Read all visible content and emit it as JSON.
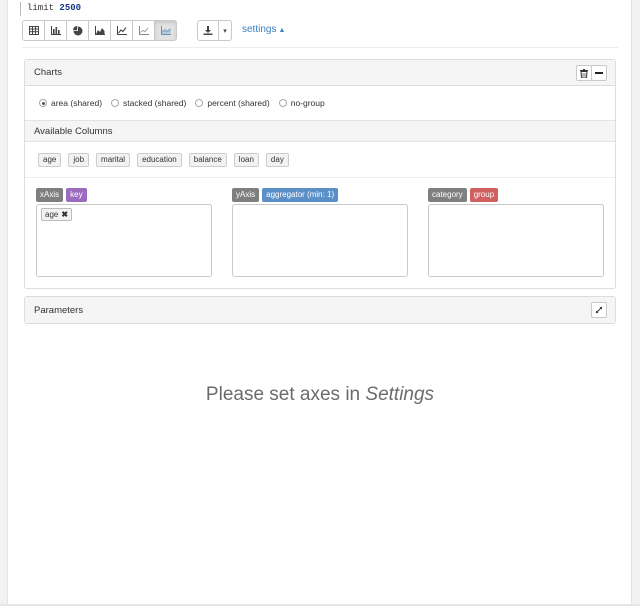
{
  "query": {
    "keyword": "limit",
    "number": "2500"
  },
  "toolbar": {
    "view_buttons": [
      {
        "name": "table-view-button",
        "icon": "table-icon",
        "active": false
      },
      {
        "name": "bar-chart-button",
        "icon": "bar-chart-icon",
        "active": false
      },
      {
        "name": "pie-chart-button",
        "icon": "pie-chart-icon",
        "active": false
      },
      {
        "name": "area-chart-button",
        "icon": "area-chart-icon",
        "active": false
      },
      {
        "name": "line-chart-button",
        "icon": "line-chart-icon",
        "active": false
      },
      {
        "name": "scatter-chart-button",
        "icon": "scatter-chart-icon",
        "active": false
      },
      {
        "name": "stacked-area-chart-button",
        "icon": "stacked-area-chart-icon",
        "active": true
      }
    ],
    "settings_label": "settings",
    "accent_color": "#3b82c4"
  },
  "charts_panel": {
    "title": "Charts",
    "options": [
      {
        "label": "area (shared)",
        "checked": true
      },
      {
        "label": "stacked (shared)",
        "checked": false
      },
      {
        "label": "percent (shared)",
        "checked": false
      },
      {
        "label": "no-group",
        "checked": false
      }
    ],
    "available_columns_title": "Available Columns",
    "columns": [
      "age",
      "job",
      "marital",
      "education",
      "balance",
      "loan",
      "day"
    ],
    "xaxis": {
      "label": "xAxis",
      "tag": "key",
      "chips": [
        "age"
      ]
    },
    "yaxis": {
      "label": "yAxis",
      "tag": "aggregator (min: 1)"
    },
    "category": {
      "label": "category",
      "tag": "group"
    }
  },
  "parameters_panel": {
    "title": "Parameters"
  },
  "message": {
    "prefix": "Please set axes in",
    "emphasis": "Settings"
  }
}
